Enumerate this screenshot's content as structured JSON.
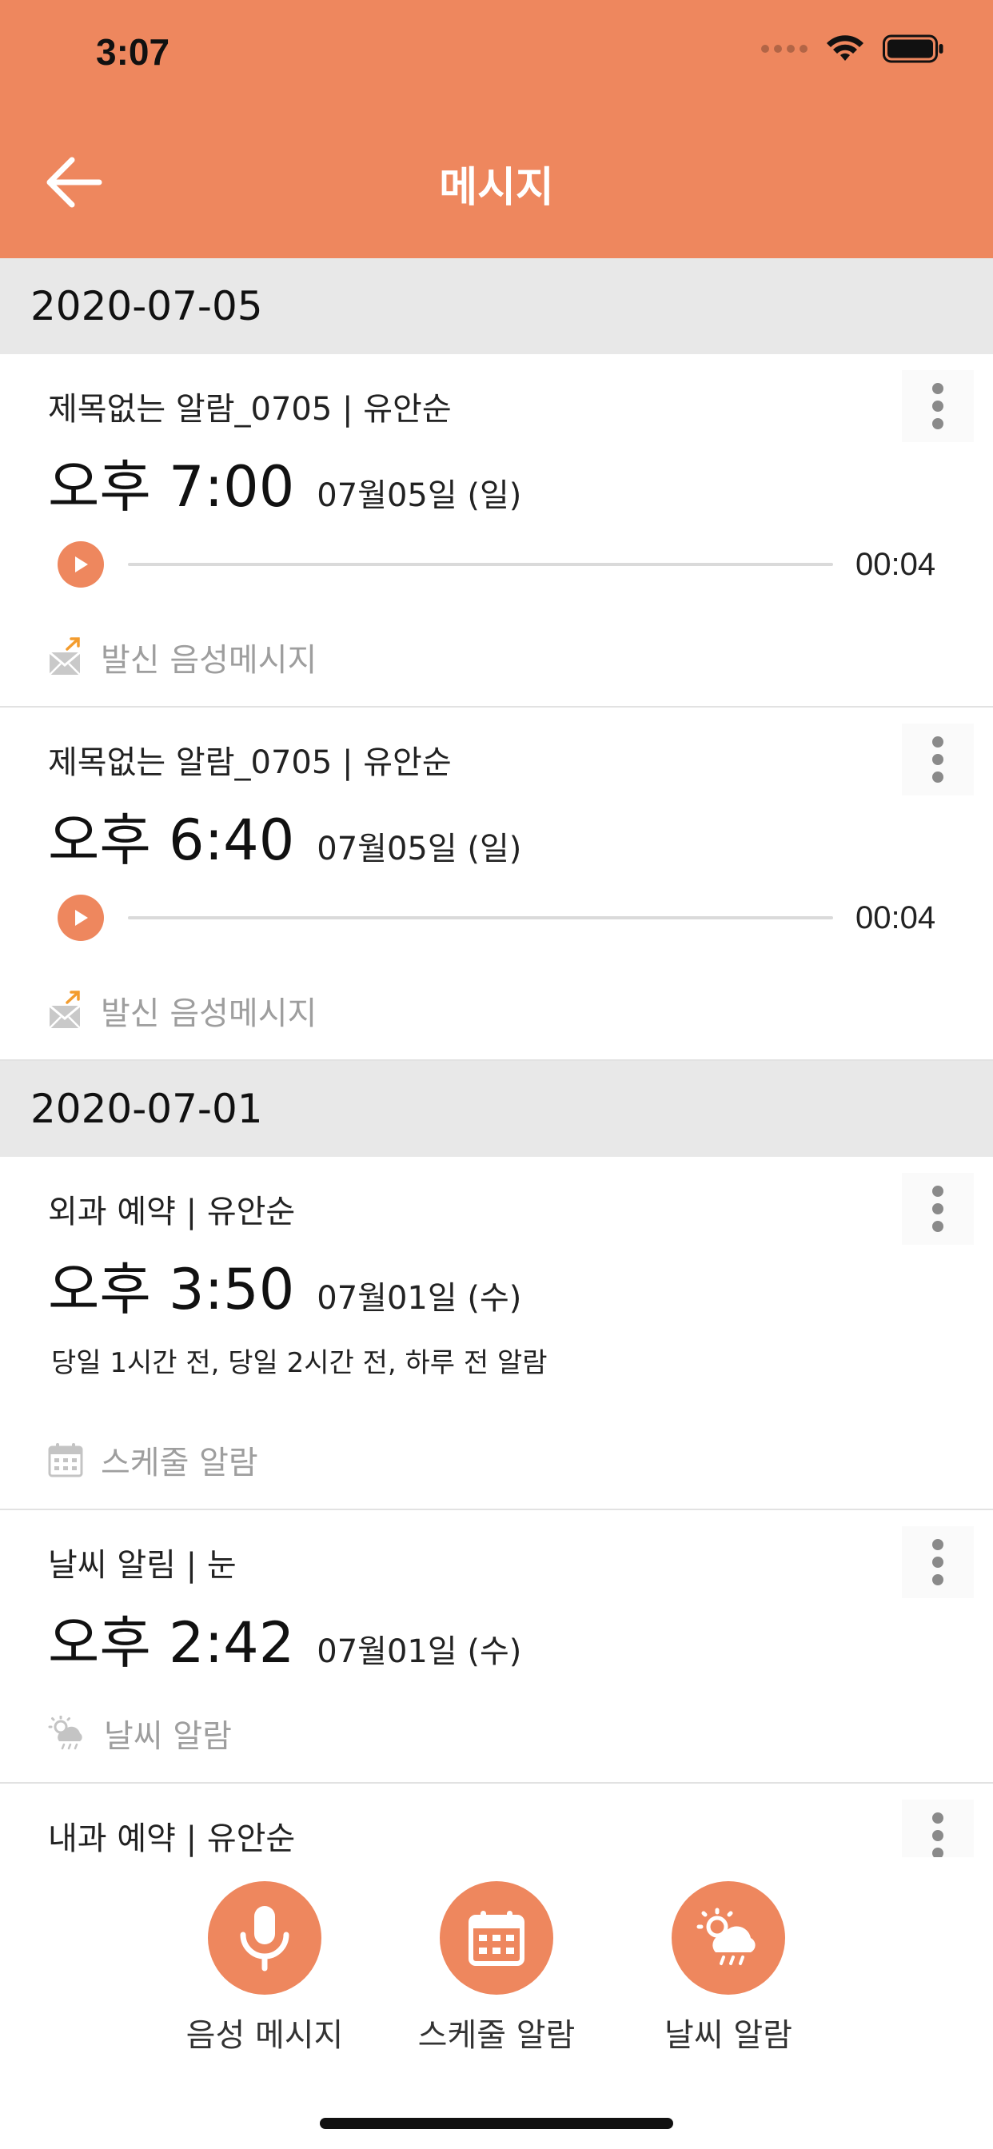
{
  "status_bar": {
    "time": "3:07"
  },
  "header": {
    "title": "메시지",
    "back_icon": "arrow-left-icon",
    "bg_color": "#EE875E"
  },
  "sections": [
    {
      "date": "2020-07-05",
      "items": [
        {
          "title": "제목없는 알람_0705 | 유안순",
          "time": "오후 7:00",
          "date": "07월05일 (일)",
          "duration": "00:04",
          "progress": 0,
          "type_label": "발신 음성메시지"
        },
        {
          "title": "제목없는 알람_0705 | 유안순",
          "time": "오후 6:40",
          "date": "07월05일 (일)",
          "duration": "00:04",
          "progress": 0,
          "type_label": "발신 음성메시지"
        }
      ]
    },
    {
      "date": "2020-07-01",
      "items": [
        {
          "title": "외과 예약 | 유안순",
          "time": "오후 3:50",
          "date": "07월01일 (수)",
          "description": "당일 1시간 전, 당일 2시간 전, 하루 전 알람",
          "type_label": "스케줄 알람"
        },
        {
          "title": "날씨 알림 | 눈",
          "time": "오후 2:42",
          "date": "07월01일 (수)",
          "type_label": "날씨 알람"
        },
        {
          "title": "내과 예약 | 유안순"
        }
      ]
    }
  ],
  "bottom_actions": [
    {
      "label": "음성 메시지",
      "icon": "microphone-icon"
    },
    {
      "label": "스케줄 알람",
      "icon": "calendar-icon"
    },
    {
      "label": "날씨 알람",
      "icon": "weather-icon"
    }
  ],
  "colors": {
    "accent": "#EE875E",
    "section_bg": "#E8E8E8",
    "muted_text": "#9E9E9E"
  }
}
